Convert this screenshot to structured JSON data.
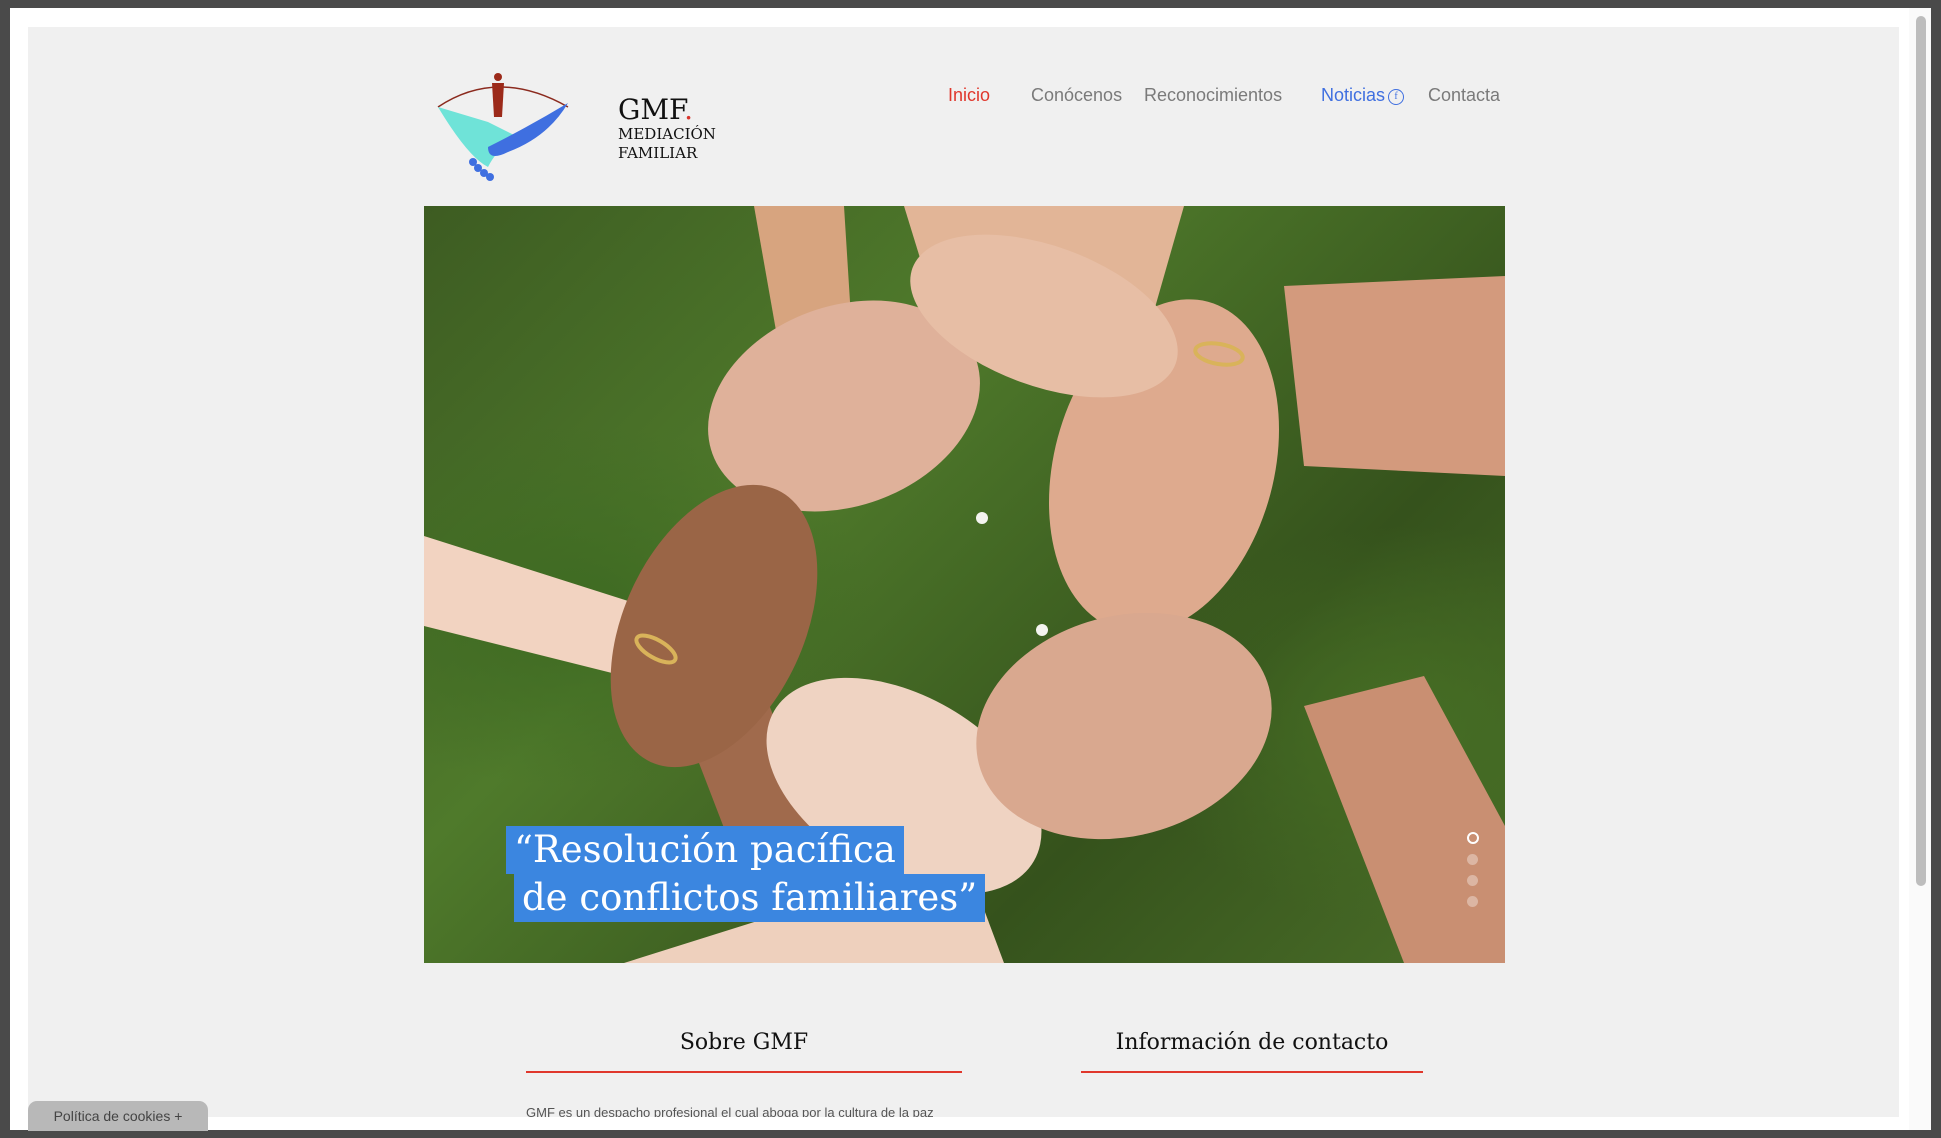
{
  "brand": {
    "name": "GMF",
    "dot": ".",
    "line1": "MEDIACIÓN",
    "line2": "FAMILIAR"
  },
  "nav": {
    "items": [
      {
        "label": "Inicio"
      },
      {
        "label": "Conócenos"
      },
      {
        "label": "Reconocimientos"
      },
      {
        "label": "Noticias"
      },
      {
        "label": "Contacta"
      }
    ],
    "facebook_icon_glyph": "f"
  },
  "hero": {
    "quote_line1": "“Resolución pacífica",
    "quote_line2": "de conflictos familiares”",
    "slides_total": 4,
    "active_slide": 1
  },
  "sections": {
    "about_title": "Sobre GMF",
    "contact_title": "Información de contacto",
    "about_text": "GMF es un despacho profesional el cual aboga por la cultura de la paz"
  },
  "cookie": {
    "label": "Política de cookies +"
  },
  "colors": {
    "accent_red": "#e0372c",
    "link_blue": "#3f6fe0",
    "quote_highlight": "#3b86e0",
    "page_bg": "#f0f0f0"
  }
}
